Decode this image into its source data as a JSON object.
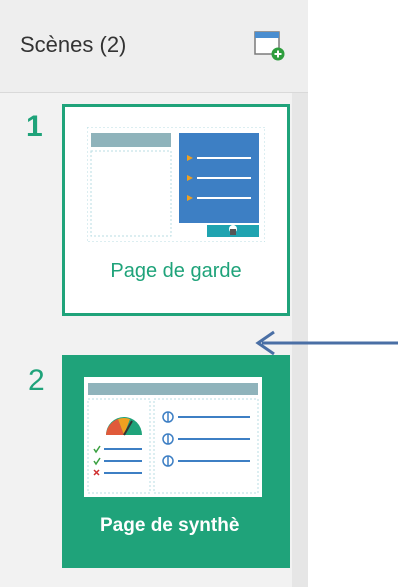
{
  "panel": {
    "title": "Scènes (2)",
    "add_scene_icon": "add-scene-icon"
  },
  "scenes": [
    {
      "number": "1",
      "label": "Page de garde",
      "selected": false
    },
    {
      "number": "2",
      "label": "Page de synthè",
      "selected": true
    }
  ],
  "colors": {
    "accent": "#1fa37a",
    "thumb_blue": "#3d7fc4",
    "annotation_arrow": "#4a6fa5"
  }
}
